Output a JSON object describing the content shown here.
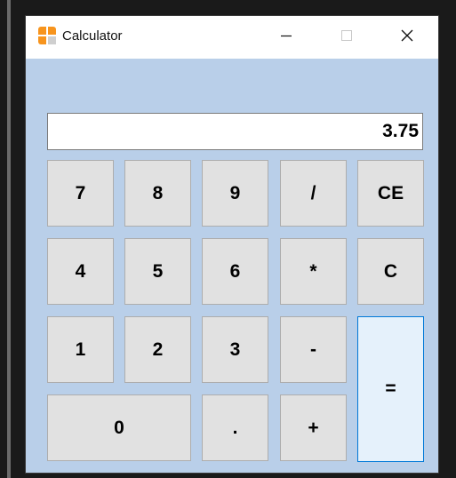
{
  "window": {
    "title": "Calculator",
    "icon": "calculator-icon",
    "controls": {
      "minimize": "minimize-icon",
      "maximize": "maximize-icon",
      "close": "close-icon"
    }
  },
  "display": {
    "value": "3.75"
  },
  "keys": {
    "k7": "7",
    "k8": "8",
    "k9": "9",
    "divide": "/",
    "ce": "CE",
    "k4": "4",
    "k5": "5",
    "k6": "6",
    "multiply": "*",
    "clear": "C",
    "k1": "1",
    "k2": "2",
    "k3": "3",
    "subtract": "-",
    "equals": "=",
    "k0": "0",
    "decimal": ".",
    "add": "+"
  },
  "colors": {
    "client_bg": "#b9cfe9",
    "titlebar_bg": "#ffffff",
    "button_bg": "#e1e1e1",
    "button_border": "#adadad",
    "focused_bg": "#e5f1fb",
    "focused_border": "#0078d7",
    "icon_orange": "#f7941d"
  }
}
